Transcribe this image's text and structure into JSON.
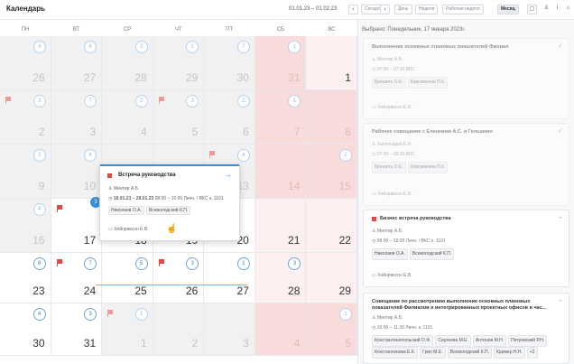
{
  "header": {
    "title": "Календарь",
    "date_range": "01.01.23 – 01.02.23",
    "today": "Сегодня",
    "views": [
      "День",
      "Неделя",
      "Рабочая неделя",
      "Месяц"
    ]
  },
  "weekdays": [
    "ПН",
    "ВТ",
    "СР",
    "ЧТ",
    "ПТ",
    "СБ",
    "ВС"
  ],
  "weeks": [
    [
      {
        "d": "26",
        "c": "4",
        "o": true
      },
      {
        "d": "27",
        "c": "6",
        "o": true
      },
      {
        "d": "28",
        "c": "3",
        "o": true
      },
      {
        "d": "29",
        "c": "2",
        "o": true
      },
      {
        "d": "30",
        "c": "7",
        "o": true
      },
      {
        "d": "31",
        "c": "1",
        "o": true,
        "w": true
      },
      {
        "d": "1",
        "c": "",
        "o": false,
        "w": true
      }
    ],
    [
      {
        "d": "2",
        "c": "3",
        "o": true,
        "f": true
      },
      {
        "d": "3",
        "c": "7",
        "o": true
      },
      {
        "d": "4",
        "c": "2",
        "o": true
      },
      {
        "d": "5",
        "c": "3",
        "o": true,
        "f": true
      },
      {
        "d": "6",
        "c": "2",
        "o": true
      },
      {
        "d": "7",
        "c": "1",
        "o": true,
        "w": true
      },
      {
        "d": "8",
        "c": "",
        "o": true,
        "w": true
      }
    ],
    [
      {
        "d": "9",
        "c": "3",
        "o": true
      },
      {
        "d": "10",
        "c": "6",
        "o": true
      },
      {
        "d": "11",
        "c": "",
        "o": true
      },
      {
        "d": "12",
        "c": "",
        "o": true
      },
      {
        "d": "13",
        "c": "4",
        "o": true,
        "f": true
      },
      {
        "d": "14",
        "c": "",
        "o": true,
        "w": true
      },
      {
        "d": "15",
        "c": "2",
        "o": true,
        "w": true
      }
    ],
    [
      {
        "d": "16",
        "c": "4",
        "o": true
      },
      {
        "d": "17",
        "c": "",
        "o": false,
        "f": true
      },
      {
        "d": "18",
        "c": "",
        "o": false
      },
      {
        "d": "19",
        "c": "",
        "o": false
      },
      {
        "d": "20",
        "c": "",
        "o": false
      },
      {
        "d": "21",
        "c": "",
        "o": false,
        "w": true
      },
      {
        "d": "22",
        "c": "",
        "o": false,
        "w": true
      }
    ],
    [
      {
        "d": "23",
        "c": "8",
        "o": false
      },
      {
        "d": "24",
        "c": "7",
        "o": false,
        "f": true
      },
      {
        "d": "25",
        "c": "5",
        "o": false
      },
      {
        "d": "26",
        "c": "3",
        "o": false,
        "f": true
      },
      {
        "d": "27",
        "c": "1",
        "o": false
      },
      {
        "d": "28",
        "c": "3",
        "o": false,
        "w": true
      },
      {
        "d": "29",
        "c": "",
        "o": false,
        "w": true
      }
    ],
    [
      {
        "d": "30",
        "c": "4",
        "o": false
      },
      {
        "d": "31",
        "c": "3",
        "o": false
      },
      {
        "d": "1",
        "c": "1",
        "o": true,
        "f": true
      },
      {
        "d": "2",
        "c": "",
        "o": true
      },
      {
        "d": "3",
        "c": "",
        "o": true
      },
      {
        "d": "4",
        "c": "",
        "o": true,
        "w": true
      },
      {
        "d": "5",
        "c": "1",
        "o": true,
        "w": true
      }
    ]
  ],
  "selected_day": "3",
  "popup": {
    "title": "Встреча руководства",
    "person": "Минтир А.Б.",
    "datetime": "18.01.23 – 28.01.23",
    "time": "08:00 – 10:00",
    "place": "Личн. / ВКС к. 1101",
    "tags": [
      "Николаев О.А.",
      "Всеволодский К.П."
    ],
    "author": "Хейнриксон Е.В."
  },
  "panel": {
    "header": "Выбрано: Понедельник, 17 января 2023г.",
    "cards": [
      {
        "title": "Выполнение основных плановых показателей Филиал",
        "person": "Минтир А.Б.",
        "time": "07:00 – 07:30",
        "place": "ВКС",
        "tags": [
          "Брешеть О.Е.",
          "Кавсименов П.К."
        ],
        "author": "Хейнриксон Е.В."
      },
      {
        "title": "Рабочее совещание с Еленевим А.С. и Гельшкин",
        "person": "Хаселсадев Е.Н.",
        "time": "07:30 – 09:30",
        "place": "ВКС",
        "tags": [
          "Брешеть О.Е.",
          "Кавсименов П.К."
        ],
        "author": "Хейнриксон Е.В."
      },
      {
        "title": "Бизнес встреча руководства",
        "person": "Минтир А.Б.",
        "time": "08:00 – 10:00",
        "place": "Личн. / ВКС к. 1101",
        "tags": [
          "Николаев О.А.",
          "Всеволодский К.П."
        ],
        "author": "Хейнриксон Е.В."
      },
      {
        "title": "Совещание по рассмотрению выполнение основных плановых показателей Филиалов и интегрированных проектных офисов в час...",
        "person": "Минтир А.Б.",
        "time": "10:00 – 11:30",
        "place": "Личн. к. 1101",
        "tags": [
          "Константинопольский О.Ф.",
          "Сергеева М.Е.",
          "Антонов М.Н.",
          "Петровский Р.Н.",
          "Константинова Е.К.",
          "Грин М.Е.",
          "Всеволодский К.П.",
          "Кремер Н.Н.",
          "+2"
        ]
      }
    ]
  }
}
